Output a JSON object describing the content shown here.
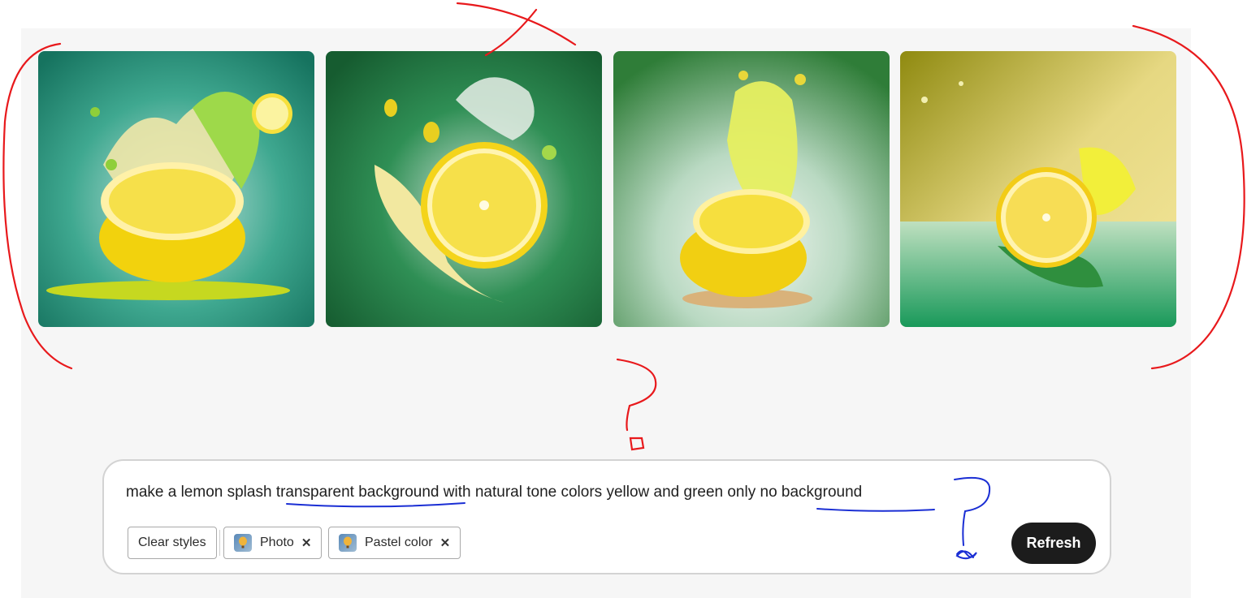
{
  "prompt": {
    "text": "make a lemon splash transparent background with natural tone colors yellow and green only no background"
  },
  "styles": {
    "clear_label": "Clear styles",
    "chips": [
      {
        "label": "Photo",
        "remove_icon": "close-icon"
      },
      {
        "label": "Pastel color",
        "remove_icon": "close-icon"
      }
    ]
  },
  "actions": {
    "refresh_label": "Refresh"
  },
  "images": [
    {
      "subject": "lemon half with yellow-green splash",
      "background": "teal"
    },
    {
      "subject": "lemon half with clear water splash",
      "background": "dark green"
    },
    {
      "subject": "lemon half with yellow juice burst",
      "background": "green to pale"
    },
    {
      "subject": "lemon half with yellow splash",
      "background": "olive-yellow to green"
    }
  ],
  "colors": {
    "annotation_red": "#e8191c",
    "annotation_blue": "#1a2ed4",
    "refresh_bg": "#1c1c1c"
  }
}
